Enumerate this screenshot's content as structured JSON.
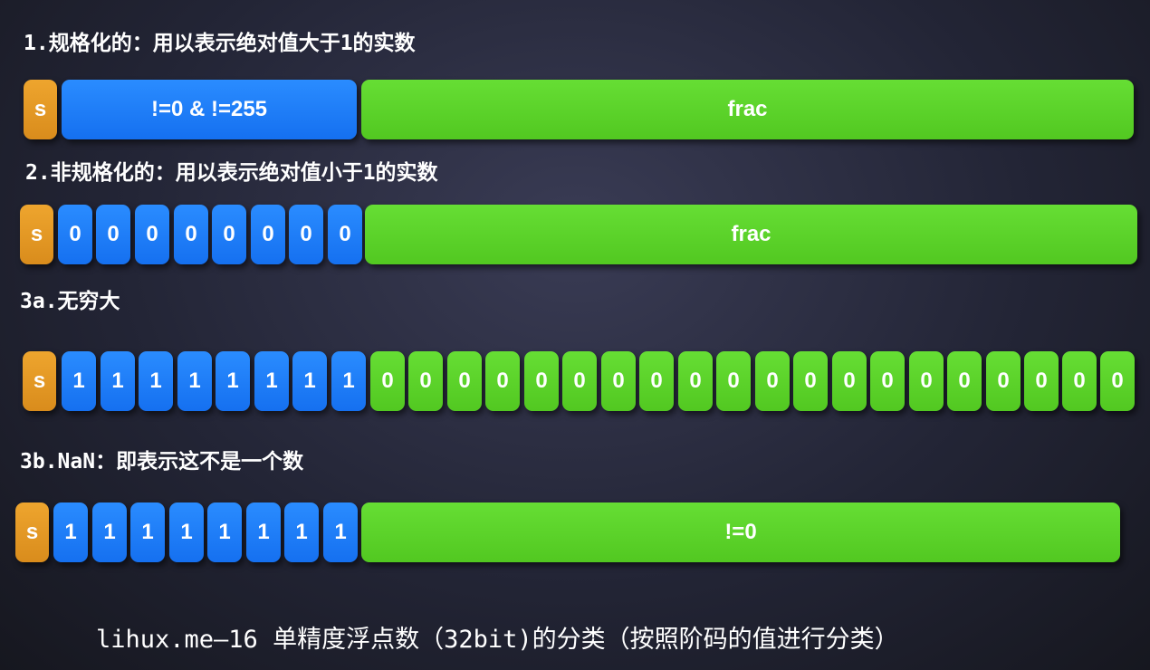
{
  "sections": {
    "normalized": {
      "heading": "1.规格化的：用以表示绝对值大于1的实数",
      "sign": "s",
      "exponent": "!=0 & !=255",
      "fraction": "frac"
    },
    "denormalized": {
      "heading": "2.非规格化的：用以表示绝对值小于1的实数",
      "sign": "s",
      "exponent_bits": [
        "0",
        "0",
        "0",
        "0",
        "0",
        "0",
        "0",
        "0"
      ],
      "fraction": "frac"
    },
    "infinity": {
      "heading": "3a.无穷大",
      "sign": "s",
      "exponent_bits": [
        "1",
        "1",
        "1",
        "1",
        "1",
        "1",
        "1",
        "1"
      ],
      "fraction_bits": [
        "0",
        "0",
        "0",
        "0",
        "0",
        "0",
        "0",
        "0",
        "0",
        "0",
        "0",
        "0",
        "0",
        "0",
        "0",
        "0",
        "0",
        "0",
        "0",
        "0"
      ]
    },
    "nan": {
      "heading": "3b.NaN：即表示这不是一个数",
      "sign": "s",
      "exponent_bits": [
        "1",
        "1",
        "1",
        "1",
        "1",
        "1",
        "1",
        "1"
      ],
      "fraction": "!=0"
    }
  },
  "caption": "lihux.me—16 单精度浮点数（32bit)的分类（按照阶码的值进行分类）",
  "colors": {
    "sign": "#e39620",
    "exponent": "#1a7cf8",
    "fraction": "#5fd62c",
    "text": "#ffffff"
  }
}
